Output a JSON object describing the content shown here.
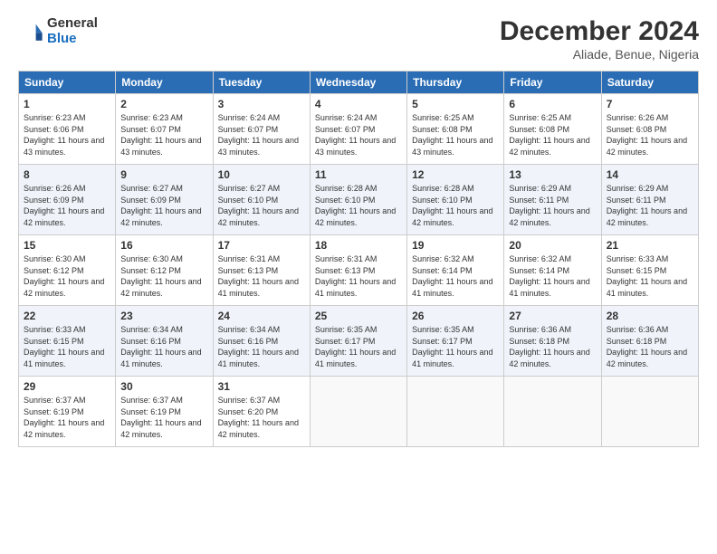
{
  "header": {
    "logo_general": "General",
    "logo_blue": "Blue",
    "month_title": "December 2024",
    "location": "Aliade, Benue, Nigeria"
  },
  "days_of_week": [
    "Sunday",
    "Monday",
    "Tuesday",
    "Wednesday",
    "Thursday",
    "Friday",
    "Saturday"
  ],
  "weeks": [
    [
      {
        "day": "1",
        "sunrise": "6:23 AM",
        "sunset": "6:06 PM",
        "daylight": "11 hours and 43 minutes."
      },
      {
        "day": "2",
        "sunrise": "6:23 AM",
        "sunset": "6:07 PM",
        "daylight": "11 hours and 43 minutes."
      },
      {
        "day": "3",
        "sunrise": "6:24 AM",
        "sunset": "6:07 PM",
        "daylight": "11 hours and 43 minutes."
      },
      {
        "day": "4",
        "sunrise": "6:24 AM",
        "sunset": "6:07 PM",
        "daylight": "11 hours and 43 minutes."
      },
      {
        "day": "5",
        "sunrise": "6:25 AM",
        "sunset": "6:08 PM",
        "daylight": "11 hours and 43 minutes."
      },
      {
        "day": "6",
        "sunrise": "6:25 AM",
        "sunset": "6:08 PM",
        "daylight": "11 hours and 42 minutes."
      },
      {
        "day": "7",
        "sunrise": "6:26 AM",
        "sunset": "6:08 PM",
        "daylight": "11 hours and 42 minutes."
      }
    ],
    [
      {
        "day": "8",
        "sunrise": "6:26 AM",
        "sunset": "6:09 PM",
        "daylight": "11 hours and 42 minutes."
      },
      {
        "day": "9",
        "sunrise": "6:27 AM",
        "sunset": "6:09 PM",
        "daylight": "11 hours and 42 minutes."
      },
      {
        "day": "10",
        "sunrise": "6:27 AM",
        "sunset": "6:10 PM",
        "daylight": "11 hours and 42 minutes."
      },
      {
        "day": "11",
        "sunrise": "6:28 AM",
        "sunset": "6:10 PM",
        "daylight": "11 hours and 42 minutes."
      },
      {
        "day": "12",
        "sunrise": "6:28 AM",
        "sunset": "6:10 PM",
        "daylight": "11 hours and 42 minutes."
      },
      {
        "day": "13",
        "sunrise": "6:29 AM",
        "sunset": "6:11 PM",
        "daylight": "11 hours and 42 minutes."
      },
      {
        "day": "14",
        "sunrise": "6:29 AM",
        "sunset": "6:11 PM",
        "daylight": "11 hours and 42 minutes."
      }
    ],
    [
      {
        "day": "15",
        "sunrise": "6:30 AM",
        "sunset": "6:12 PM",
        "daylight": "11 hours and 42 minutes."
      },
      {
        "day": "16",
        "sunrise": "6:30 AM",
        "sunset": "6:12 PM",
        "daylight": "11 hours and 42 minutes."
      },
      {
        "day": "17",
        "sunrise": "6:31 AM",
        "sunset": "6:13 PM",
        "daylight": "11 hours and 41 minutes."
      },
      {
        "day": "18",
        "sunrise": "6:31 AM",
        "sunset": "6:13 PM",
        "daylight": "11 hours and 41 minutes."
      },
      {
        "day": "19",
        "sunrise": "6:32 AM",
        "sunset": "6:14 PM",
        "daylight": "11 hours and 41 minutes."
      },
      {
        "day": "20",
        "sunrise": "6:32 AM",
        "sunset": "6:14 PM",
        "daylight": "11 hours and 41 minutes."
      },
      {
        "day": "21",
        "sunrise": "6:33 AM",
        "sunset": "6:15 PM",
        "daylight": "11 hours and 41 minutes."
      }
    ],
    [
      {
        "day": "22",
        "sunrise": "6:33 AM",
        "sunset": "6:15 PM",
        "daylight": "11 hours and 41 minutes."
      },
      {
        "day": "23",
        "sunrise": "6:34 AM",
        "sunset": "6:16 PM",
        "daylight": "11 hours and 41 minutes."
      },
      {
        "day": "24",
        "sunrise": "6:34 AM",
        "sunset": "6:16 PM",
        "daylight": "11 hours and 41 minutes."
      },
      {
        "day": "25",
        "sunrise": "6:35 AM",
        "sunset": "6:17 PM",
        "daylight": "11 hours and 41 minutes."
      },
      {
        "day": "26",
        "sunrise": "6:35 AM",
        "sunset": "6:17 PM",
        "daylight": "11 hours and 41 minutes."
      },
      {
        "day": "27",
        "sunrise": "6:36 AM",
        "sunset": "6:18 PM",
        "daylight": "11 hours and 42 minutes."
      },
      {
        "day": "28",
        "sunrise": "6:36 AM",
        "sunset": "6:18 PM",
        "daylight": "11 hours and 42 minutes."
      }
    ],
    [
      {
        "day": "29",
        "sunrise": "6:37 AM",
        "sunset": "6:19 PM",
        "daylight": "11 hours and 42 minutes."
      },
      {
        "day": "30",
        "sunrise": "6:37 AM",
        "sunset": "6:19 PM",
        "daylight": "11 hours and 42 minutes."
      },
      {
        "day": "31",
        "sunrise": "6:37 AM",
        "sunset": "6:20 PM",
        "daylight": "11 hours and 42 minutes."
      },
      null,
      null,
      null,
      null
    ]
  ]
}
